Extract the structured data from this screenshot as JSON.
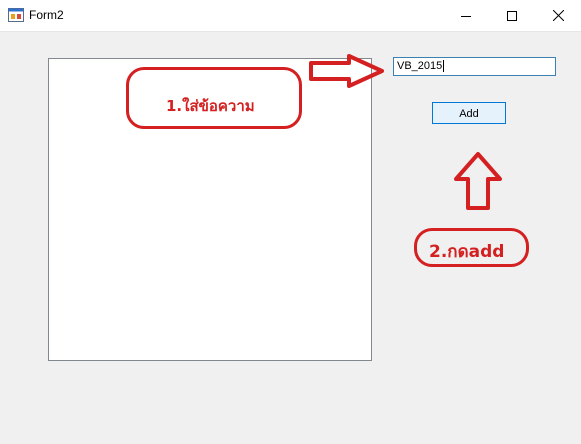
{
  "window": {
    "title": "Form2",
    "icons": {
      "app": "form-app-icon",
      "minimize": "minimize-icon",
      "maximize": "maximize-icon",
      "close": "close-icon"
    }
  },
  "form": {
    "textbox_value": "VB_2015",
    "add_button_label": "Add"
  },
  "annotations": {
    "step1": "1.ใส่ข้อความ",
    "step2": "2.กดadd",
    "color": "#d42020"
  },
  "colors": {
    "window_bg": "#f0f0f0",
    "accent": "#0078d7"
  }
}
